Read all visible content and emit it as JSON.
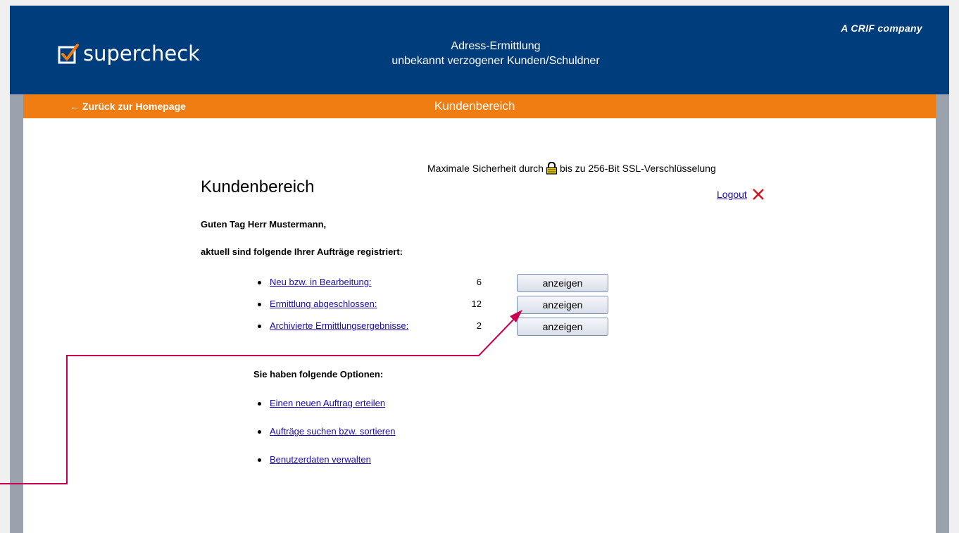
{
  "header": {
    "logo_text": "supercheck",
    "title_line1": "Adress-Ermittlung",
    "title_line2": "unbekannt verzogener Kunden/Schuldner",
    "company_prefix": "A ",
    "company_name": "CRIF company",
    "bg_color": "#003d7c"
  },
  "navbar": {
    "back_link": "← Zurück zur Homepage",
    "title": "Kundenbereich",
    "bg_color": "#ef7d12"
  },
  "security": {
    "text_before": "Maximale Sicherheit durch",
    "text_after": "bis zu 256-Bit SSL-Verschlüsselung",
    "icon": "lock-icon"
  },
  "main": {
    "heading": "Kundenbereich",
    "logout_label": "Logout",
    "greeting": "Guten Tag Herr Mustermann,",
    "registered_text": "aktuell sind folgende Ihrer Aufträge registriert:",
    "orders": [
      {
        "label": "Neu bzw. in Bearbeitung:",
        "count": "6",
        "button": "anzeigen"
      },
      {
        "label": "Ermittlung abgeschlossen:",
        "count": "12",
        "button": "anzeigen"
      },
      {
        "label": "Archivierte Ermittlungsergebnisse:",
        "count": "2",
        "button": "anzeigen"
      }
    ],
    "options_heading": "Sie haben folgende Optionen:",
    "options": [
      {
        "label": "Einen neuen Auftrag erteilen"
      },
      {
        "label": "Aufträge suchen bzw. sortieren"
      },
      {
        "label": "Benutzerdaten verwalten"
      }
    ]
  },
  "annotation_color": "#c8004f"
}
